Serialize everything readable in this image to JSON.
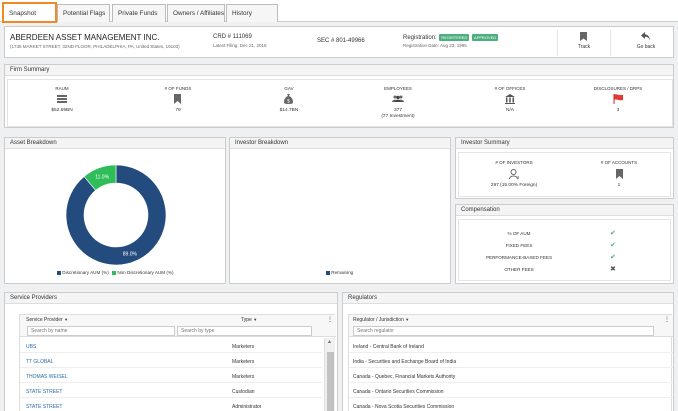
{
  "tabs": [
    {
      "label": "Snapshot",
      "active": true
    },
    {
      "label": "Potential Flags"
    },
    {
      "label": "Private Funds"
    },
    {
      "label": "Owners / Affiliates"
    },
    {
      "label": "History"
    }
  ],
  "firm": {
    "name": "ABERDEEN ASSET MANAGEMENT INC.",
    "address": "(1735 MARKET STREET, 32ND FLOOR, PHILADELPHIA, PA, United States, 19103)",
    "crd": "CRD # 111069",
    "latest_filing": "Latest Filing: Dec 21, 2016",
    "sec": "SEC # 801-49966",
    "registration_label": "Registration:",
    "badge_registered": "REGISTERED",
    "badge_approved": "APPROVED",
    "registration_date": "Registration Date: Aug 23, 1995",
    "track_label": "Track",
    "go_back_label": "Go back"
  },
  "firm_summary": {
    "title": "Firm Summary",
    "items": [
      {
        "label": "RAUM",
        "value": "$52.69BN",
        "icon": "money-icon"
      },
      {
        "label": "# OF FUNDS",
        "value": "79",
        "icon": "bookmark-icon"
      },
      {
        "label": "GAV",
        "value": "$14.7BN",
        "icon": "money-bag-icon"
      },
      {
        "label": "EMPLOYEES",
        "value": "377",
        "value2": "(77 Investment)",
        "icon": "people-icon"
      },
      {
        "label": "# OF OFFICES",
        "value": "N/A",
        "icon": "bank-icon"
      },
      {
        "label": "DISCLOSURES / DRPS",
        "value": "3",
        "icon": "flag-icon"
      }
    ]
  },
  "asset_breakdown": {
    "title": "Asset Breakdown",
    "legend_discretionary": "Discretionary AUM (%)",
    "legend_non_discretionary": "Non Discretionary AUM (%)",
    "label_discretionary": "89.0%",
    "label_non_discretionary": "11.0%",
    "color_discretionary": "#244b7e",
    "color_non_discretionary": "#2ebd59"
  },
  "chart_data": {
    "type": "pie",
    "categories": [
      "Discretionary AUM (%)",
      "Non Discretionary AUM (%)"
    ],
    "values": [
      89.0,
      11.0
    ]
  },
  "investor_breakdown": {
    "title": "Investor Breakdown",
    "legend_remaining": "Remaining"
  },
  "investor_summary": {
    "title": "Investor Summary",
    "investors_label": "# OF INVESTORS",
    "investors_value": "297 (15.00% Foreign)",
    "accounts_label": "# OF ACCOUNTS",
    "accounts_value": "1"
  },
  "compensation": {
    "title": "Compensation",
    "rows": [
      {
        "label": "% OF AUM",
        "status": "✔"
      },
      {
        "label": "FIXED FEES",
        "status": "✔"
      },
      {
        "label": "PERFORMANCE-BASED FEES",
        "status": "✔"
      },
      {
        "label": "OTHER FEES",
        "status": "✖"
      }
    ]
  },
  "service_providers": {
    "title": "Service Providers",
    "col_provider": "Service Provider",
    "col_type": "Type",
    "search_name_placeholder": "Search by name",
    "search_type_placeholder": "Search by type",
    "rows": [
      {
        "name": "UBS",
        "type": "Marketers"
      },
      {
        "name": "TT GLOBAL",
        "type": "Marketers"
      },
      {
        "name": "THOMAS WEISEL",
        "type": "Marketers"
      },
      {
        "name": "STATE STREET",
        "type": "Custodian"
      },
      {
        "name": "STATE STREET",
        "type": "Administrator"
      }
    ]
  },
  "regulators": {
    "title": "Regulators",
    "col_regulator": "Regulator / Jurisdiction",
    "search_placeholder": "Search regulator",
    "rows": [
      "Ireland - Central Bank of Ireland",
      "India - Securities and Exchange Board of India",
      "Canada - Quebec, Financial Markets Authority",
      "Canada - Ontario Securities Commission",
      "Canada - Nova Scotia Securities Commission"
    ]
  }
}
